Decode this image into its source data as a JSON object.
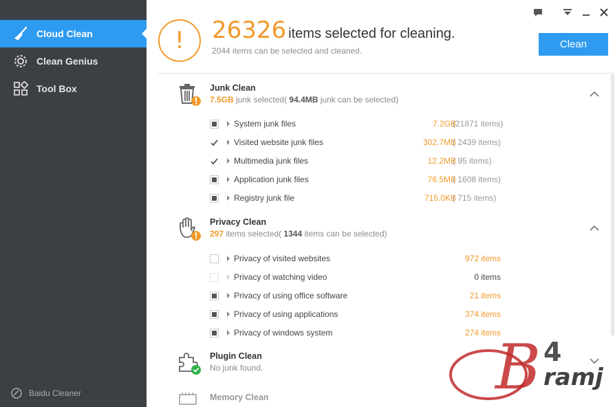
{
  "sidebar": {
    "items": [
      {
        "label": "Cloud Clean",
        "icon": "broom-icon",
        "active": true
      },
      {
        "label": "Clean Genius",
        "icon": "gear-icon",
        "active": false
      },
      {
        "label": "Tool Box",
        "icon": "grid-icon",
        "active": false
      }
    ],
    "brand": "Baidu Cleaner"
  },
  "header": {
    "count": "26326",
    "title_suffix": "items selected for cleaning.",
    "sub_count": "2044",
    "sub_suffix": "items can be selected and cleaned.",
    "clean_label": "Clean"
  },
  "junk": {
    "title": "Junk Clean",
    "selected": "7.5GB",
    "mid": "junk selected(",
    "can": "94.4MB",
    "tail": "junk can be selected)",
    "rows": [
      {
        "label": "System junk files",
        "size": "7.2GB",
        "count": "(21871 items)",
        "state": "partial"
      },
      {
        "label": "Visited website junk files",
        "size": "302.7MB",
        "count": "( 2439 items)",
        "state": "checked"
      },
      {
        "label": "Multimedia junk files",
        "size": "12.2MB",
        "count": "(    95 items)",
        "state": "checked"
      },
      {
        "label": "Application junk files",
        "size": "76.5MB",
        "count": "( 1608 items)",
        "state": "partial"
      },
      {
        "label": "Registry junk file",
        "size": "715.0KB",
        "count": "(  715 items)",
        "state": "partial"
      }
    ]
  },
  "privacy": {
    "title": "Privacy Clean",
    "selected": "297",
    "mid": "items selected(",
    "can": "1344",
    "tail": "items can be selected)",
    "rows": [
      {
        "label": "Privacy of visited websites",
        "items": "972 items",
        "state": "empty"
      },
      {
        "label": "Privacy of watching video",
        "items": "0 items",
        "state": "faint"
      },
      {
        "label": "Privacy of using office software",
        "items": "21 items",
        "state": "partial"
      },
      {
        "label": "Privacy of using applications",
        "items": "374 items",
        "state": "partial"
      },
      {
        "label": "Privacy of windows system",
        "items": "274 items",
        "state": "partial"
      }
    ]
  },
  "plugin": {
    "title": "Plugin Clean",
    "sub": "No junk found."
  },
  "memory": {
    "title": "Memory Clean"
  },
  "colors": {
    "accent": "#2e9bf0",
    "orange": "#f09a2a",
    "sidebar": "#3c3f44",
    "ok": "#2fb24c"
  }
}
